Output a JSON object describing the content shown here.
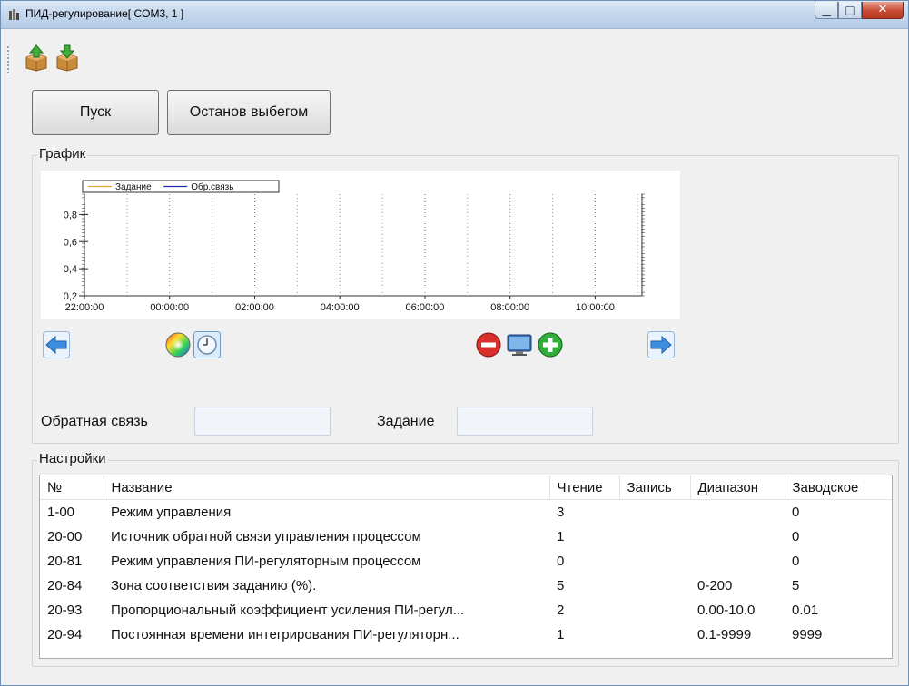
{
  "window": {
    "title": "ПИД-регулирование[ COM3, 1 ]"
  },
  "toolbar": {
    "import_icon": "box-arrow-up-icon",
    "export_icon": "box-arrow-down-icon"
  },
  "buttons": {
    "start": "Пуск",
    "stop": "Останов выбегом"
  },
  "chart_group": {
    "label": "График"
  },
  "chart_data": {
    "type": "line",
    "legend": [
      "Задание",
      "Обр.связь"
    ],
    "legend_placement": "top-left",
    "series_colors": {
      "Задание": "#e8a33c",
      "Обр.связь": "#1c2fa8"
    },
    "x_ticks": [
      "22:00:00",
      "00:00:00",
      "02:00:00",
      "04:00:00",
      "06:00:00",
      "08:00:00",
      "10:00:00"
    ],
    "y_ticks": [
      "0,2",
      "0,4",
      "0,6",
      "0,8"
    ],
    "ylim": [
      0.2,
      0.95
    ],
    "grid": "dotted-vertical",
    "series": [
      {
        "name": "Задание",
        "values": []
      },
      {
        "name": "Обр.связь",
        "values": []
      }
    ]
  },
  "chart_controls": {
    "back": "arrow-left-icon",
    "color": "color-wheel-icon",
    "clock": "clock-icon",
    "zoom_out": "minus-circle-icon",
    "screen": "monitor-icon",
    "zoom_in": "plus-circle-icon",
    "forward": "arrow-right-icon"
  },
  "fields": {
    "feedback_label": "Обратная связь",
    "feedback_value": "",
    "setpoint_label": "Задание",
    "setpoint_value": ""
  },
  "settings": {
    "label": "Настройки",
    "columns": [
      "№",
      "Название",
      "Чтение",
      "Запись",
      "Диапазон",
      "Заводское"
    ],
    "rows": [
      [
        "1-00",
        "Режим управления",
        "3",
        "",
        "",
        "0"
      ],
      [
        "20-00",
        "Источник обратной связи управления процессом",
        "1",
        "",
        "",
        "0"
      ],
      [
        "20-81",
        "Режим управления ПИ-регуляторным процессом",
        "0",
        "",
        "",
        "0"
      ],
      [
        "20-84",
        "Зона соответствия заданию (%).",
        "5",
        "",
        "0-200",
        "5"
      ],
      [
        "20-93",
        "Пропорциональный коэффициент усиления ПИ-регул...",
        "2",
        "",
        "0.00-10.0",
        "0.01"
      ],
      [
        "20-94",
        "Постоянная времени интегрирования ПИ-регуляторн...",
        "1",
        "",
        "0.1-9999",
        "9999"
      ]
    ]
  }
}
